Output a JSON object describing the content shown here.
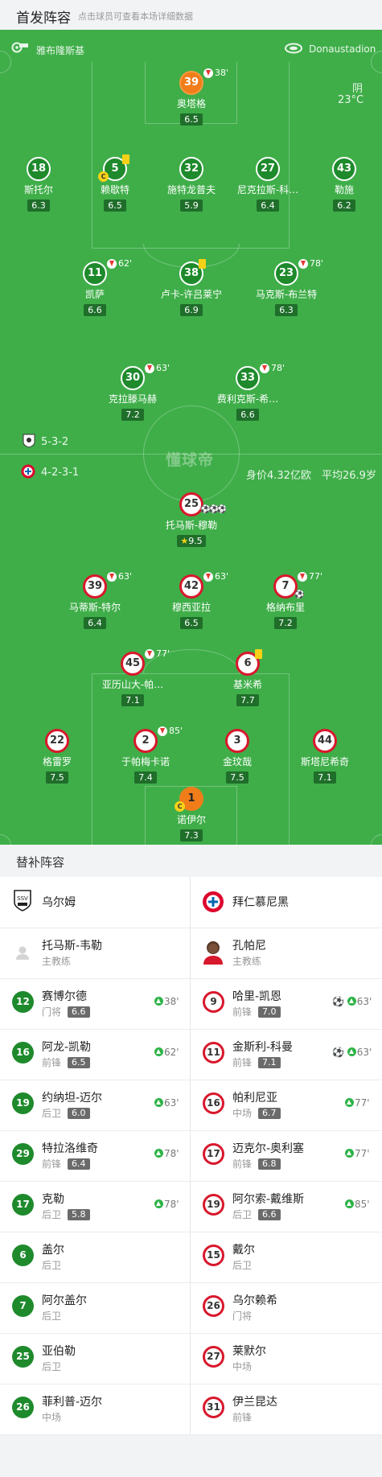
{
  "header": {
    "title": "首发阵容",
    "hint": "点击球员可查看本场详细数据"
  },
  "pitch": {
    "referee": "雅布隆斯基",
    "stadium": "Donaustadion",
    "weather": "阴",
    "temperature": "23°C",
    "watermark": "懂球帝",
    "home_formation": "5-3-2",
    "away_formation": "4-2-3-1",
    "value_label": "身价4.32亿欧",
    "avg_age_label": "平均26.9岁"
  },
  "home_lineup": [
    {
      "number": "39",
      "name": "奥塔格",
      "rating": "6.5",
      "sub_time": "38'"
    },
    {
      "number": "18",
      "name": "斯托尔",
      "rating": "6.3"
    },
    {
      "number": "5",
      "name": "赖歇特",
      "rating": "6.5"
    },
    {
      "number": "32",
      "name": "施特龙普夫",
      "rating": "5.9"
    },
    {
      "number": "27",
      "name": "尼克拉斯-科…",
      "rating": "6.4"
    },
    {
      "number": "43",
      "name": "勒施",
      "rating": "6.2"
    },
    {
      "number": "11",
      "name": "凯萨",
      "rating": "6.6",
      "sub_time": "62'"
    },
    {
      "number": "38",
      "name": "卢卡-许吕莱宁",
      "rating": "6.9"
    },
    {
      "number": "23",
      "name": "马克斯-布兰特",
      "rating": "6.3",
      "sub_time": "78'"
    },
    {
      "number": "30",
      "name": "克拉滕马赫",
      "rating": "7.2",
      "sub_time": "63'"
    },
    {
      "number": "33",
      "name": "费利克斯-希…",
      "rating": "6.6",
      "sub_time": "78'"
    }
  ],
  "away_lineup": [
    {
      "number": "25",
      "name": "托马斯-穆勒",
      "rating": "9.5"
    },
    {
      "number": "39",
      "name": "马蒂斯-特尔",
      "rating": "6.4",
      "sub_time": "63'"
    },
    {
      "number": "42",
      "name": "穆西亚拉",
      "rating": "6.5",
      "sub_time": "63'"
    },
    {
      "number": "7",
      "name": "格纳布里",
      "rating": "7.2",
      "sub_time": "77'"
    },
    {
      "number": "45",
      "name": "亚历山大-帕…",
      "rating": "7.1",
      "sub_time": "77'"
    },
    {
      "number": "6",
      "name": "基米希",
      "rating": "7.7"
    },
    {
      "number": "22",
      "name": "格雷罗",
      "rating": "7.5"
    },
    {
      "number": "2",
      "name": "于帕梅卡诺",
      "rating": "7.4",
      "sub_time": "85'"
    },
    {
      "number": "3",
      "name": "金玟哉",
      "rating": "7.5"
    },
    {
      "number": "44",
      "name": "斯塔尼希奇",
      "rating": "7.1"
    },
    {
      "number": "1",
      "name": "诺伊尔",
      "rating": "7.3"
    }
  ],
  "subs": {
    "title": "替补阵容",
    "home_team": "乌尔姆",
    "away_team": "拜仁慕尼黑",
    "home_coach": {
      "name": "托马斯-韦勒",
      "role": "主教练"
    },
    "away_coach": {
      "name": "孔帕尼",
      "role": "主教练"
    },
    "home": [
      {
        "number": "12",
        "name": "赛博尔德",
        "pos": "门将",
        "rating": "6.6",
        "in": "38'"
      },
      {
        "number": "16",
        "name": "阿龙-凯勒",
        "pos": "前锋",
        "rating": "6.5",
        "in": "62'"
      },
      {
        "number": "19",
        "name": "约纳坦-迈尔",
        "pos": "后卫",
        "rating": "6.0",
        "in": "63'"
      },
      {
        "number": "29",
        "name": "特拉洛维奇",
        "pos": "前锋",
        "rating": "6.4",
        "in": "78'"
      },
      {
        "number": "17",
        "name": "克勒",
        "pos": "后卫",
        "rating": "5.8",
        "in": "78'"
      },
      {
        "number": "6",
        "name": "盖尔",
        "pos": "后卫"
      },
      {
        "number": "7",
        "name": "阿尔盖尔",
        "pos": "后卫"
      },
      {
        "number": "25",
        "name": "亚伯勒",
        "pos": "后卫"
      },
      {
        "number": "26",
        "name": "菲利普-迈尔",
        "pos": "中场"
      }
    ],
    "away": [
      {
        "number": "9",
        "name": "哈里-凯恩",
        "pos": "前锋",
        "rating": "7.0",
        "in": "63'"
      },
      {
        "number": "11",
        "name": "金斯利-科曼",
        "pos": "前锋",
        "rating": "7.1",
        "in": "63'"
      },
      {
        "number": "16",
        "name": "帕利尼亚",
        "pos": "中场",
        "rating": "6.7",
        "in": "77'"
      },
      {
        "number": "17",
        "name": "迈克尔-奥利塞",
        "pos": "前锋",
        "rating": "6.8",
        "in": "77'"
      },
      {
        "number": "19",
        "name": "阿尔索-戴维斯",
        "pos": "后卫",
        "rating": "6.6",
        "in": "85'"
      },
      {
        "number": "15",
        "name": "戴尔",
        "pos": "后卫"
      },
      {
        "number": "26",
        "name": "乌尔赖希",
        "pos": "门将"
      },
      {
        "number": "27",
        "name": "莱默尔",
        "pos": "中场"
      },
      {
        "number": "31",
        "name": "伊兰昆达",
        "pos": "前锋"
      }
    ]
  }
}
